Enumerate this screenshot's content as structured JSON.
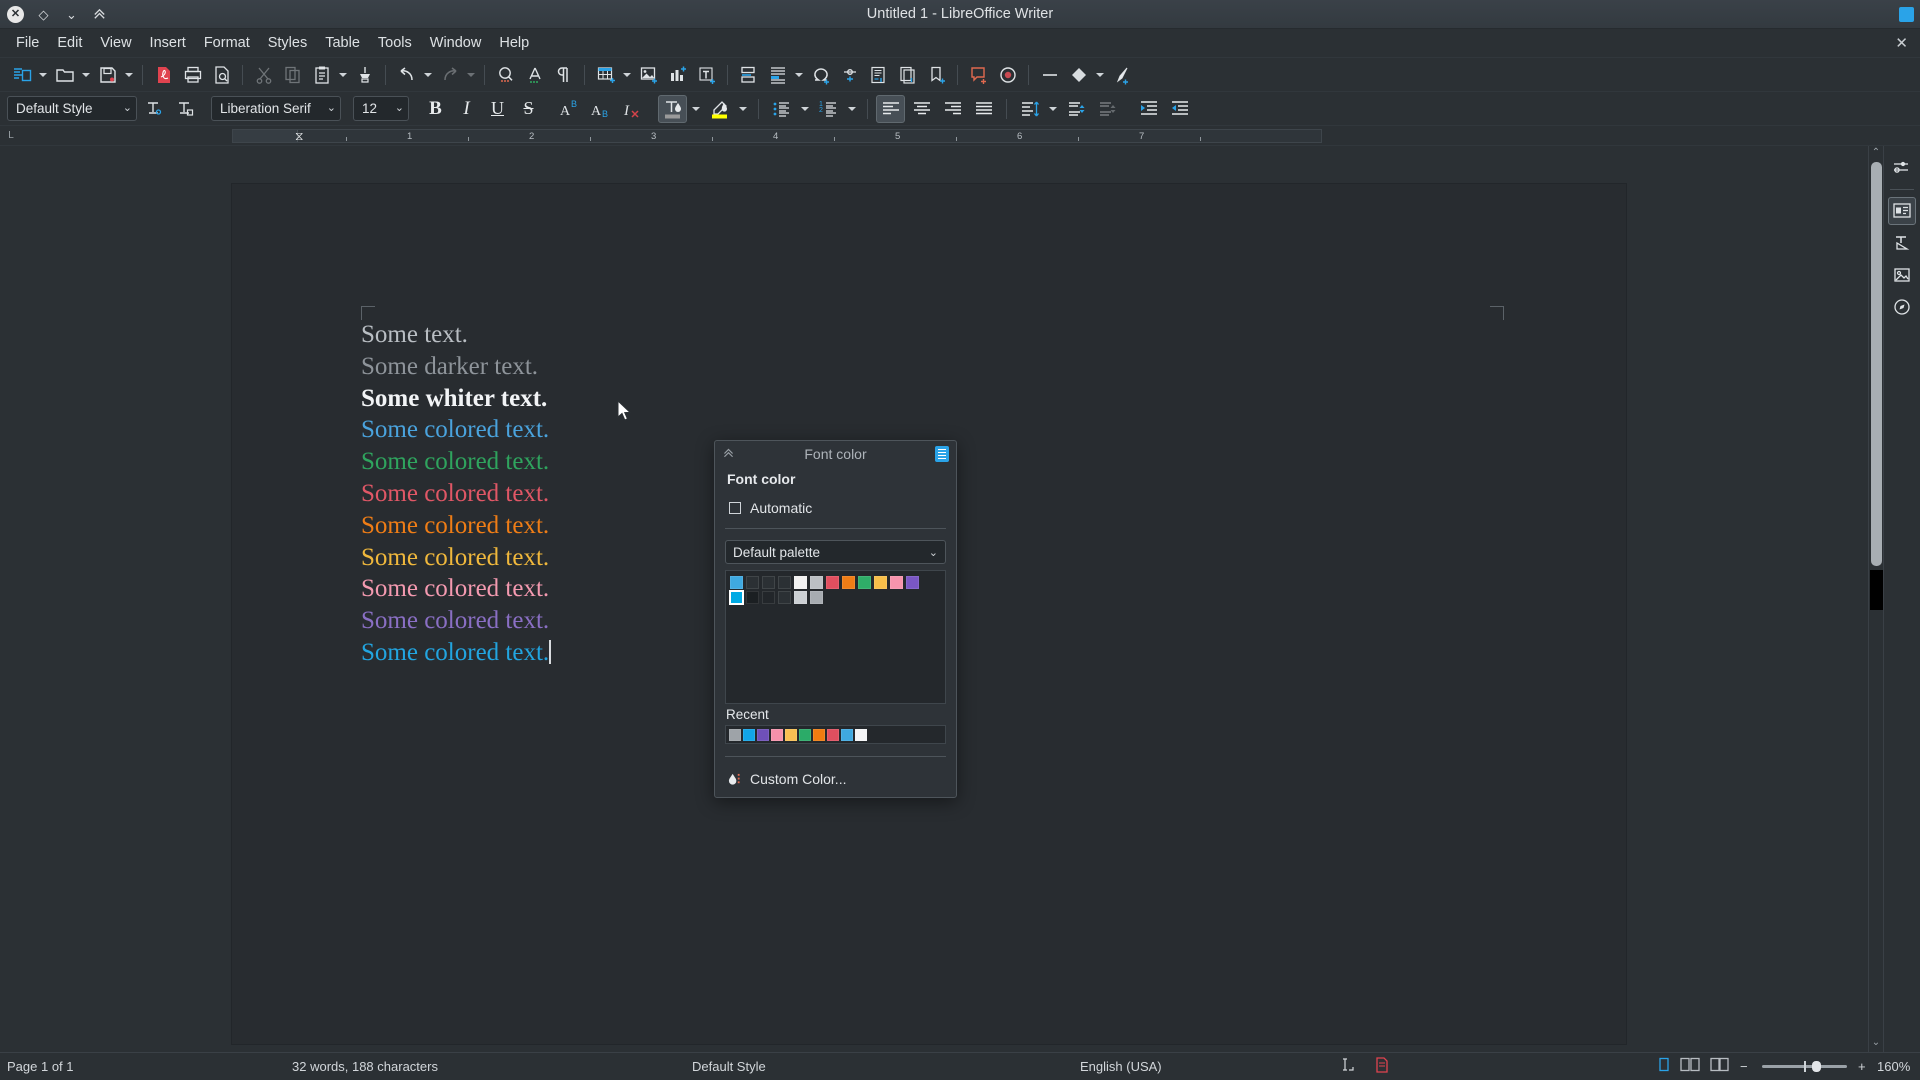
{
  "titlebar": {
    "title": "Untitled 1 - LibreOffice Writer",
    "close_glyph": "✕",
    "restore_glyph": "◇",
    "minimize_glyph": "⌄",
    "collapse_glyph": "⌃⌃",
    "window_close": "✕"
  },
  "menubar": {
    "items": [
      {
        "label": "File"
      },
      {
        "label": "Edit"
      },
      {
        "label": "View"
      },
      {
        "label": "Insert"
      },
      {
        "label": "Format"
      },
      {
        "label": "Styles"
      },
      {
        "label": "Table"
      },
      {
        "label": "Tools"
      },
      {
        "label": "Window"
      },
      {
        "label": "Help"
      }
    ],
    "close_doc": "✕"
  },
  "standard_toolbar": {
    "items": [
      {
        "name": "new-document",
        "title": "New"
      },
      {
        "name": "new-dropdown",
        "type": "caret"
      },
      {
        "name": "open-file",
        "title": "Open"
      },
      {
        "name": "open-dropdown",
        "type": "caret"
      },
      {
        "name": "save-document",
        "title": "Save"
      },
      {
        "name": "save-dropdown",
        "type": "caret"
      },
      {
        "name": "export-pdf",
        "title": "Export as PDF"
      },
      {
        "name": "print",
        "title": "Print"
      },
      {
        "name": "print-preview",
        "title": "Print Preview"
      },
      {
        "name": "cut",
        "title": "Cut",
        "disabled": true
      },
      {
        "name": "copy",
        "title": "Copy",
        "disabled": true
      },
      {
        "name": "paste",
        "title": "Paste"
      },
      {
        "name": "paste-dropdown",
        "type": "caret"
      },
      {
        "name": "clone-formatting",
        "title": "Clone Formatting"
      },
      {
        "name": "undo",
        "title": "Undo"
      },
      {
        "name": "undo-dropdown",
        "type": "caret"
      },
      {
        "name": "redo",
        "title": "Redo",
        "disabled": true
      },
      {
        "name": "redo-dropdown",
        "type": "caret",
        "disabled": true
      },
      {
        "name": "find-and-replace",
        "title": "Find and Replace"
      },
      {
        "name": "spelling",
        "title": "Check Spelling"
      },
      {
        "name": "formatting-marks",
        "title": "Formatting Marks"
      },
      {
        "name": "insert-table",
        "title": "Insert Table"
      },
      {
        "name": "insert-table-dropdown",
        "type": "caret"
      },
      {
        "name": "insert-image",
        "title": "Insert Image"
      },
      {
        "name": "insert-chart",
        "title": "Insert Chart"
      },
      {
        "name": "insert-text-box",
        "title": "Insert Text Box"
      },
      {
        "name": "insert-page-break",
        "title": "Insert Page Break"
      },
      {
        "name": "insert-field",
        "title": "Insert Field"
      },
      {
        "name": "insert-field-dropdown",
        "type": "caret"
      },
      {
        "name": "insert-special-character",
        "title": "Insert Special Character"
      },
      {
        "name": "insert-hyperlink",
        "title": "Insert Hyperlink"
      },
      {
        "name": "insert-footnote",
        "title": "Insert Footnote"
      },
      {
        "name": "insert-endnote",
        "title": "Insert Endnote"
      },
      {
        "name": "insert-bookmark",
        "title": "Insert Bookmark"
      },
      {
        "name": "insert-comment",
        "title": "Insert Comment"
      },
      {
        "name": "track-changes",
        "title": "Record Track Changes"
      },
      {
        "name": "insert-line",
        "title": "Insert Line"
      },
      {
        "name": "basic-shapes",
        "title": "Basic Shapes"
      },
      {
        "name": "basic-shapes-dropdown",
        "type": "caret"
      },
      {
        "name": "show-draw-functions",
        "title": "Show Draw Functions"
      }
    ]
  },
  "format_toolbar": {
    "paragraph_style": "Default Style",
    "font_name": "Liberation Serif",
    "font_size": "12",
    "update_style_title": "Update Selected Style",
    "new_style_title": "New Style from Selection",
    "bold": "B",
    "italic": "I",
    "underline": "U",
    "strikethrough": "S",
    "superscript": "A",
    "subscript": "A",
    "clear_formatting": "I",
    "font_color_title": "Font Color",
    "highlight_color_title": "Character Highlighting Color",
    "font_color_swatch": "#9a9a9a",
    "highlight_swatch": "#ffff00",
    "unordered_list_title": "Unordered List",
    "ordered_list_title": "Ordered List",
    "align_left_title": "Align Left",
    "align_center_title": "Align Center",
    "align_right_title": "Align Right",
    "justified_title": "Justified",
    "line_spacing_title": "Set Line Spacing",
    "paragraph_spacing_up": "Increase Paragraph Spacing",
    "paragraph_spacing_down": "Decrease Paragraph Spacing",
    "increase_indent": "Increase Indent",
    "decrease_indent": "Decrease Indent"
  },
  "ruler": {
    "corner_label": "L",
    "ticks": [
      "1",
      "2",
      "3",
      "4",
      "5",
      "6",
      "7"
    ],
    "marker_glyph": "⧖"
  },
  "document": {
    "lines": [
      {
        "text": "Some text.",
        "color": "#b9bec3",
        "bold": false
      },
      {
        "text": "Some darker text.",
        "color": "#8e949a",
        "bold": false
      },
      {
        "text": "Some whiter text.",
        "color": "#f2f4f6",
        "bold": true
      },
      {
        "text": "Some colored text.",
        "color": "#4aa3dd",
        "bold": false
      },
      {
        "text": "Some colored text.",
        "color": "#2fa45e",
        "bold": false
      },
      {
        "text": "Some colored text.",
        "color": "#e05766",
        "bold": false
      },
      {
        "text": "Some colored text.",
        "color": "#ef7d16",
        "bold": false
      },
      {
        "text": "Some colored text.",
        "color": "#f0b83c",
        "bold": false
      },
      {
        "text": "Some colored text.",
        "color": "#f49ab0",
        "bold": false
      },
      {
        "text": "Some colored text.",
        "color": "#8a6fc4",
        "bold": false
      },
      {
        "text": "Some colored text.",
        "color": "#22a5e0",
        "bold": false,
        "cursor": true
      }
    ]
  },
  "font_color_popup": {
    "header_title": "Font color",
    "section_label": "Font color",
    "automatic_label": "Automatic",
    "automatic_checked": false,
    "palette_name": "Default palette",
    "palette_rows": [
      [
        "#3fa9e0",
        "#2b3034",
        "#2b3034",
        "#2b3034",
        "#f2f2f2",
        "#bcc0c4",
        "#e14f5f",
        "#ef7d16",
        "#2fad68",
        "#f7bf4a",
        "#f794ad",
        "#7a57c4"
      ],
      [
        "#00aae4",
        "#1b1f22",
        "#22262a",
        "#2b3034",
        "#ccd0d4",
        "#a7acb1"
      ]
    ],
    "selected_index": {
      "row": 1,
      "col": 0
    },
    "recent_label": "Recent",
    "recent_colors": [
      "#9ea3a8",
      "#12a5e8",
      "#6f50b8",
      "#f591ab",
      "#f9bf52",
      "#2bab68",
      "#f07c10",
      "#e04f5f",
      "#3fa9e0",
      "#f4f5f6"
    ],
    "custom_color_label": "Custom Color...",
    "custom_color_icon": "droplet-icon"
  },
  "sidebar": {
    "items": [
      {
        "name": "sidebar-settings",
        "title": "Sidebar Settings"
      },
      {
        "name": "properties-deck",
        "title": "Properties",
        "active": true
      },
      {
        "name": "styles-deck",
        "title": "Styles"
      },
      {
        "name": "gallery-deck",
        "title": "Gallery"
      },
      {
        "name": "navigator-deck",
        "title": "Navigator"
      }
    ]
  },
  "statusbar": {
    "page_info": "Page 1 of 1",
    "word_count": "32 words, 188 characters",
    "page_style": "Default Style",
    "language": "English (USA)",
    "selection_mode_title": "Selection Mode",
    "save_state_title": "Unsaved modifications",
    "view_single_title": "Single-page view",
    "view_multi_title": "Multiple-page view",
    "view_book_title": "Book view",
    "zoom_out": "−",
    "zoom_in": "+",
    "zoom_level": "160%"
  }
}
